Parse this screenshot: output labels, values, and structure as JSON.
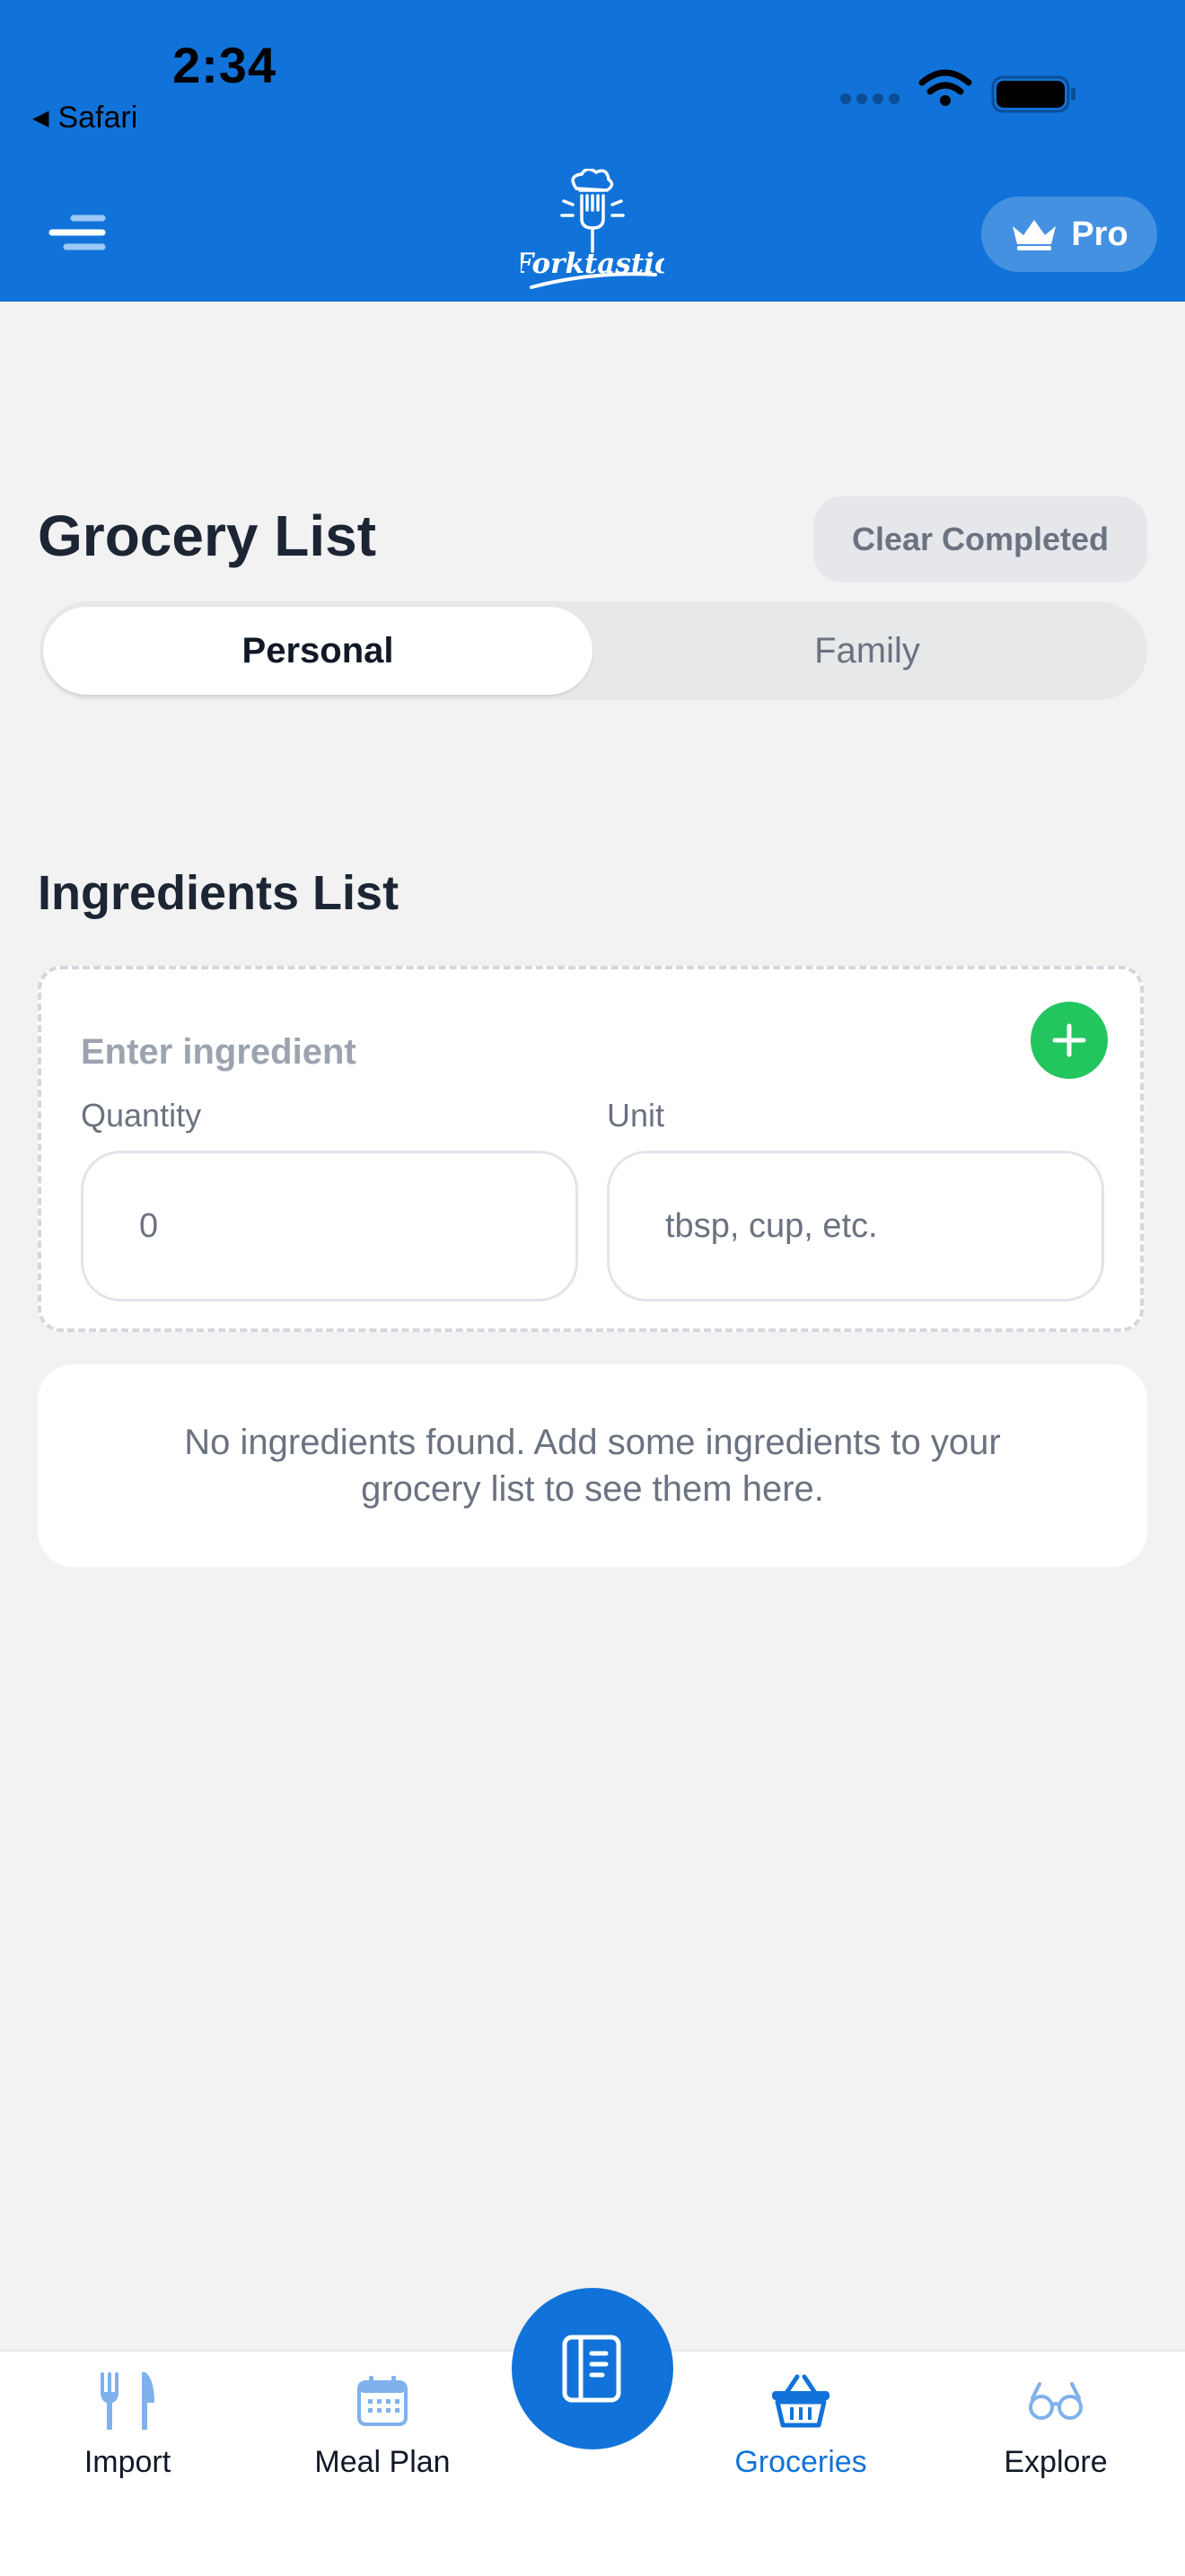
{
  "status_bar": {
    "time": "2:34",
    "back_app": "Safari"
  },
  "header": {
    "logo_text": "Forktastic",
    "pro_label": "Pro"
  },
  "page": {
    "title": "Grocery List",
    "clear_completed_label": "Clear Completed",
    "segments": [
      {
        "label": "Personal",
        "active": true
      },
      {
        "label": "Family",
        "active": false
      }
    ]
  },
  "ingredients": {
    "section_title": "Ingredients List",
    "ingredient_placeholder": "Enter ingredient",
    "quantity_label": "Quantity",
    "quantity_value": "0",
    "unit_label": "Unit",
    "unit_placeholder": "tbsp, cup, etc.",
    "empty_message": "No ingredients found. Add some ingredients to your grocery list to see them here."
  },
  "tabbar": {
    "items": [
      {
        "label": "Import",
        "icon": "fork-knife-icon",
        "active": false
      },
      {
        "label": "Meal Plan",
        "icon": "calendar-icon",
        "active": false
      },
      {
        "label": "",
        "icon": "recipe-book-icon",
        "active": false
      },
      {
        "label": "Groceries",
        "icon": "basket-icon",
        "active": true
      },
      {
        "label": "Explore",
        "icon": "glasses-icon",
        "active": false
      }
    ]
  },
  "colors": {
    "brand": "#1173d9",
    "add_button": "#22c55e",
    "background": "#f2f2f2",
    "inactive_icon": "#7fb1ec"
  }
}
